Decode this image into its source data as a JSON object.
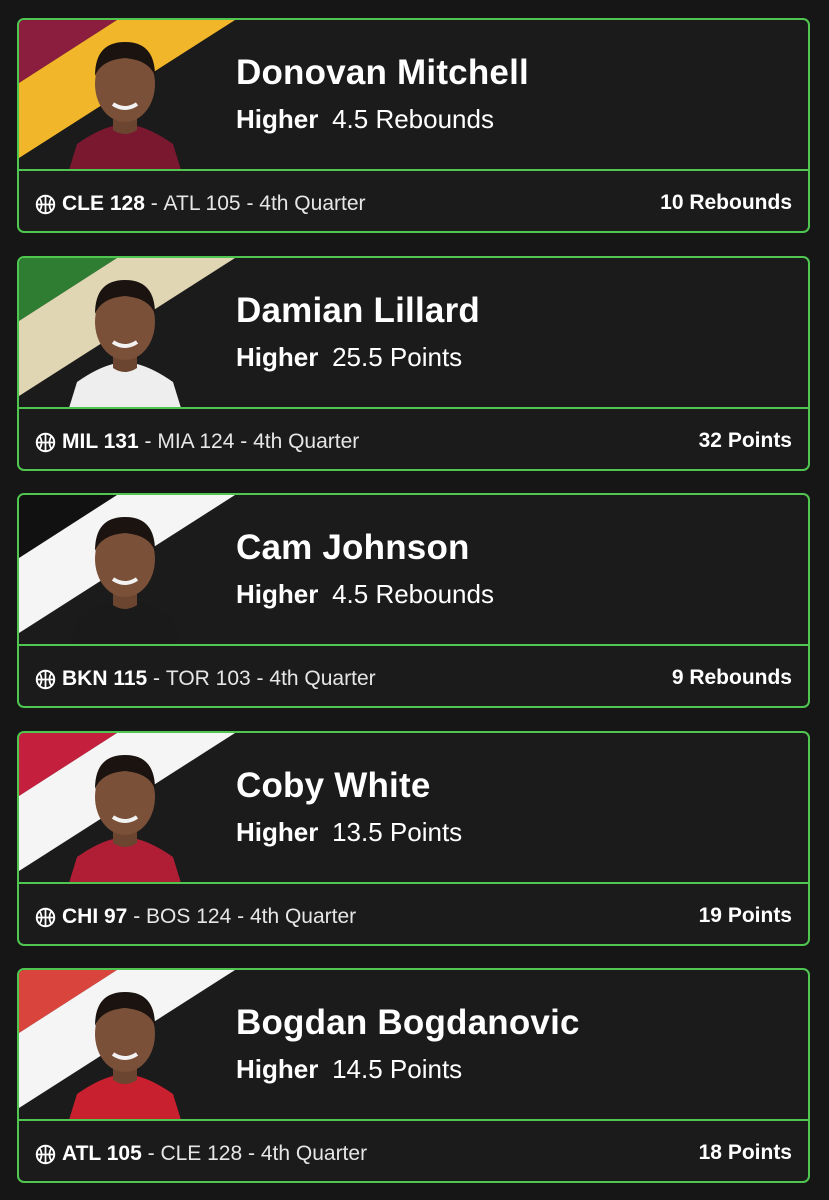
{
  "cards": [
    {
      "player": "Donovan Mitchell",
      "direction": "Higher",
      "line": "4.5 Rebounds",
      "home_score": "CLE 128",
      "away_score": "ATL 105",
      "period": "4th Quarter",
      "separator": " - ",
      "result": "10 Rebounds",
      "team_colors": [
        "#8b1e3f",
        "#f2b62a"
      ],
      "jersey_color": "#7a1830"
    },
    {
      "player": "Damian Lillard",
      "direction": "Higher",
      "line": "25.5 Points",
      "home_score": "MIL 131",
      "away_score": "MIA 124",
      "period": "4th Quarter",
      "separator": " - ",
      "result": "32 Points",
      "team_colors": [
        "#2e7d32",
        "#e0d6b4"
      ],
      "jersey_color": "#eeeeee"
    },
    {
      "player": "Cam Johnson",
      "direction": "Higher",
      "line": "4.5 Rebounds",
      "home_score": "BKN 115",
      "away_score": "TOR 103",
      "period": "4th Quarter",
      "separator": " - ",
      "result": "9 Rebounds",
      "team_colors": [
        "#111111",
        "#f5f5f5"
      ],
      "jersey_color": "#1a1a1a"
    },
    {
      "player": "Coby White",
      "direction": "Higher",
      "line": "13.5 Points",
      "home_score": "CHI 97",
      "away_score": "BOS 124",
      "period": "4th Quarter",
      "separator": " - ",
      "result": "19 Points",
      "team_colors": [
        "#c4203d",
        "#f5f5f5"
      ],
      "jersey_color": "#b01e35"
    },
    {
      "player": "Bogdan Bogdanovic",
      "direction": "Higher",
      "line": "14.5 Points",
      "home_score": "ATL 105",
      "away_score": "CLE 128",
      "period": "4th Quarter",
      "separator": " - ",
      "result": "18 Points",
      "team_colors": [
        "#d9453c",
        "#f5f5f5"
      ],
      "jersey_color": "#c8202f"
    }
  ],
  "icons": {
    "sport": "basketball-icon",
    "headshot": "player-headshot"
  },
  "colors": {
    "accent": "#4fc64f",
    "background": "#161616",
    "card": "#1b1b1b"
  }
}
